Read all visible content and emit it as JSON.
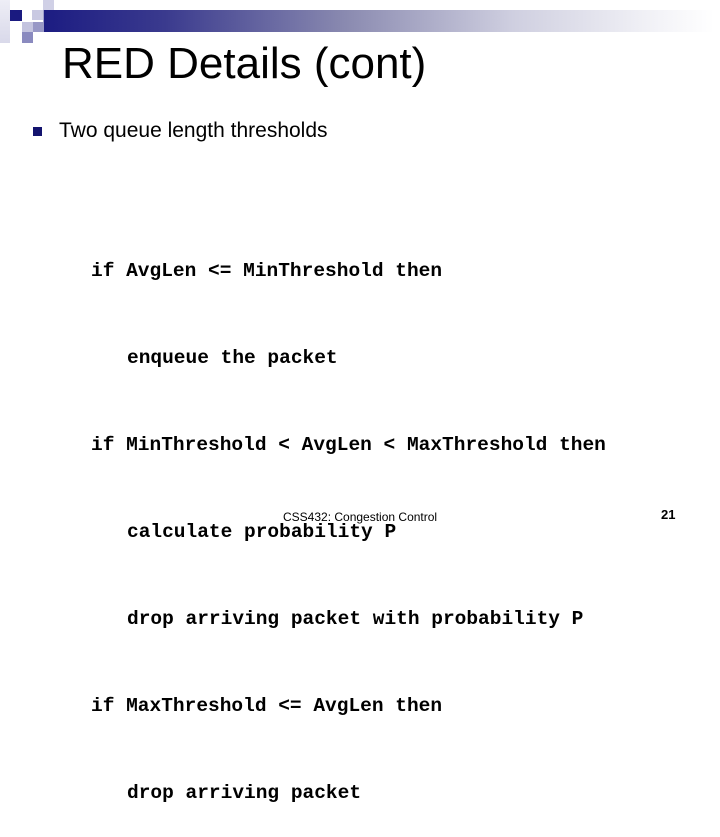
{
  "slide": {
    "title": "RED Details (cont)",
    "bullets": [
      {
        "icon": "square-bullet-icon",
        "text": "Two queue length thresholds"
      }
    ],
    "code_lines": [
      {
        "indent": false,
        "text": "if AvgLen <= MinThreshold then"
      },
      {
        "indent": true,
        "text": "enqueue the packet"
      },
      {
        "indent": false,
        "text": "if MinThreshold < AvgLen < MaxThreshold then"
      },
      {
        "indent": true,
        "text": "calculate probability P"
      },
      {
        "indent": true,
        "text": "drop arriving packet with probability P"
      },
      {
        "indent": false,
        "text": "if MaxThreshold <= AvgLen then"
      },
      {
        "indent": true,
        "text": "drop arriving packet"
      }
    ],
    "footer": "CSS432: Congestion Control",
    "page_number": "21"
  },
  "theme": {
    "accent": "#1c1c82",
    "bullet_color": "#13136e"
  }
}
